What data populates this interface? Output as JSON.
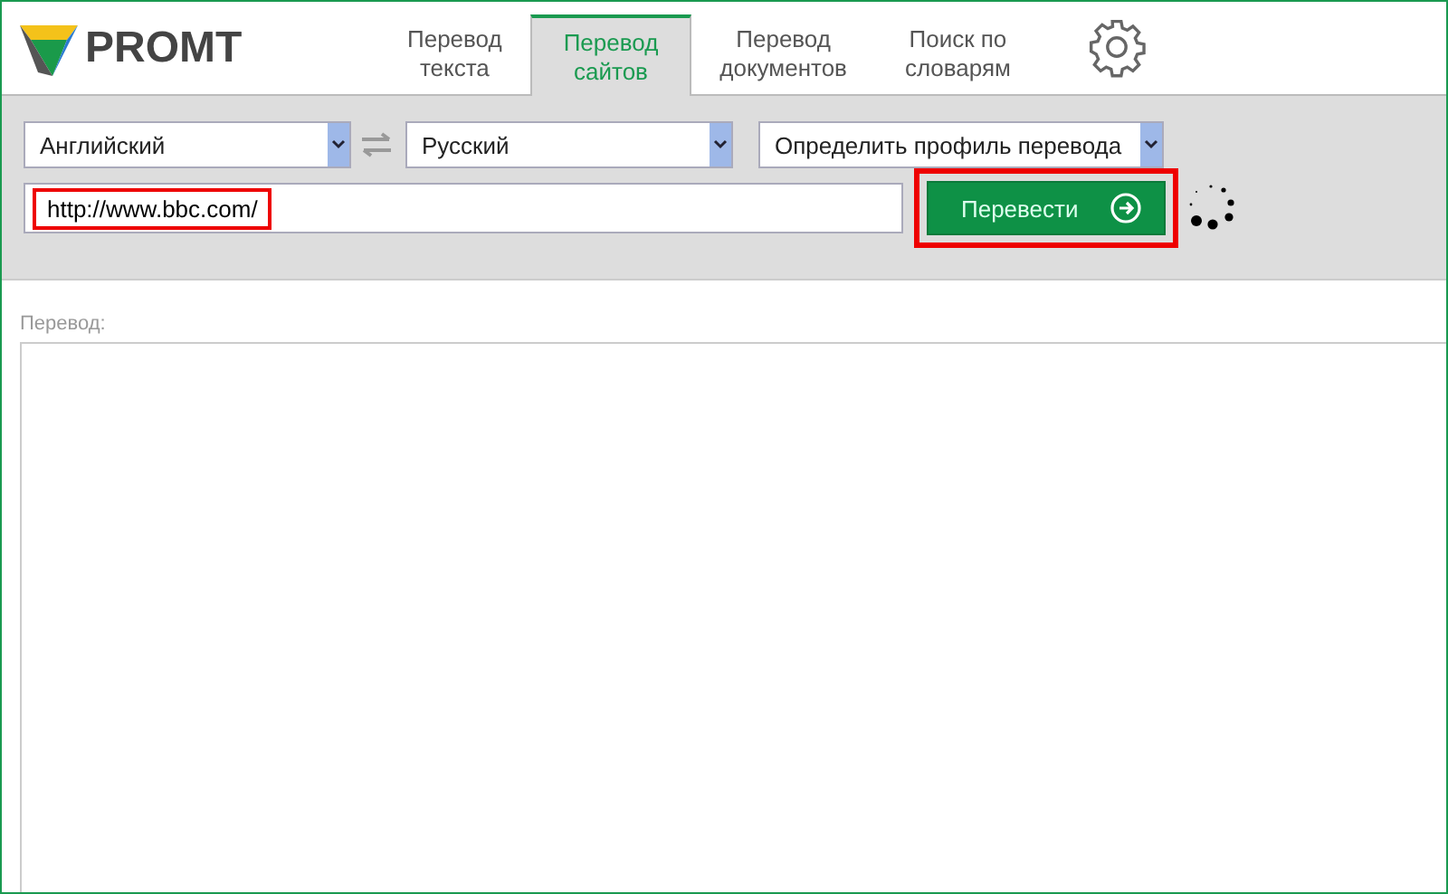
{
  "logo": {
    "text": "PROMT"
  },
  "tabs": [
    {
      "label": "Перевод\nтекста",
      "selected": false
    },
    {
      "label": "Перевод\nсайтов",
      "selected": true
    },
    {
      "label": "Перевод\nдокументов",
      "selected": false
    },
    {
      "label": "Поиск по\nсловарям",
      "selected": false
    }
  ],
  "source_language": {
    "value": "Английский"
  },
  "target_language": {
    "value": "Русский"
  },
  "profile": {
    "value": "Определить профиль перевода"
  },
  "url_field": {
    "value": "http://www.bbc.com/",
    "highlighted": true
  },
  "translate_button": {
    "label": "Перевести",
    "highlighted": true
  },
  "loading": true,
  "result": {
    "label": "Перевод:"
  }
}
